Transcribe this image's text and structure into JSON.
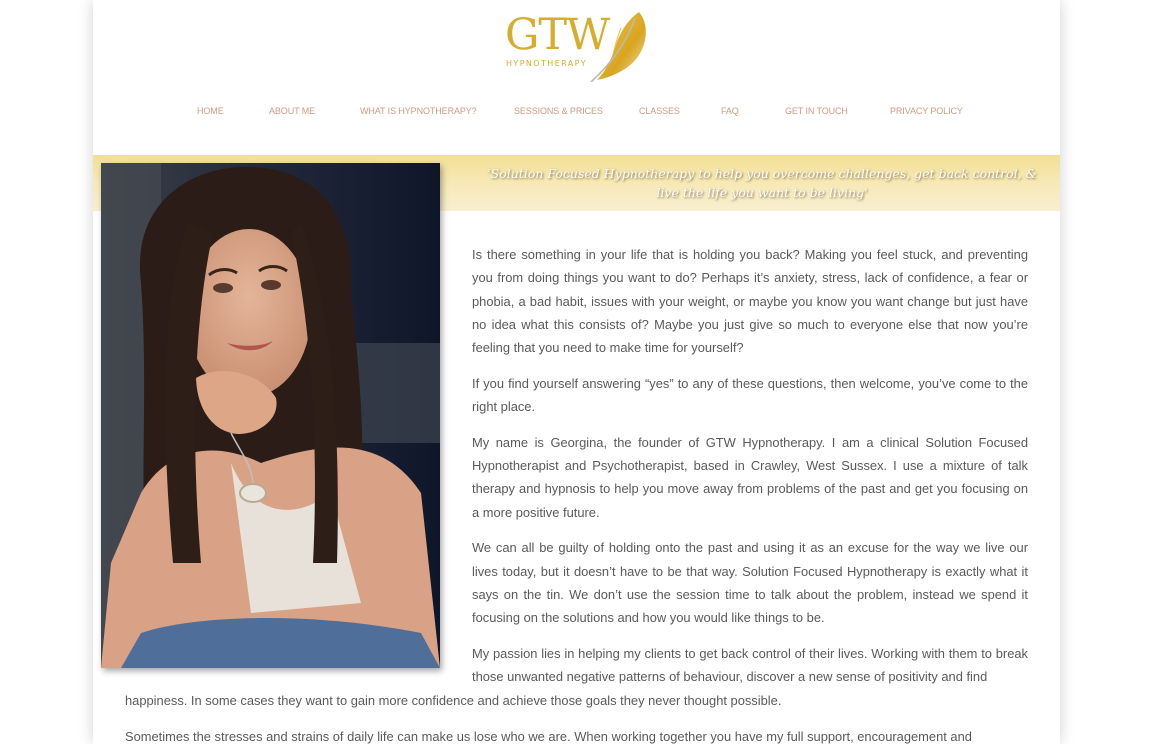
{
  "header": {
    "logo_text": "GTW",
    "logo_sub": "HYPNOTHERAPY"
  },
  "nav": {
    "items": [
      {
        "label": "HOME"
      },
      {
        "label": "ABOUT ME"
      },
      {
        "label": "WHAT IS HYPNOTHERAPY?"
      },
      {
        "label": "SESSIONS & PRICES"
      },
      {
        "label": "CLASSES"
      },
      {
        "label": "FAQ"
      },
      {
        "label": "GET IN TOUCH"
      },
      {
        "label": "PRIVACY POLICY"
      }
    ]
  },
  "banner": {
    "tagline": "'Solution Focused Hypnotherapy to help you overcome challenges, get back control, & live the life you want to be living'"
  },
  "content": {
    "paragraphs": [
      "Is there something in your life that is holding you back? Making you feel stuck, and preventing you from doing things you want to do? Perhaps it’s anxiety, stress, lack of confidence, a fear or phobia, a bad habit, issues with your weight, or maybe you know you want change but just have no idea what this consists of? Maybe you just give so much to everyone else that now you’re feeling that you need to make time for yourself?",
      "If you find yourself answering “yes” to any of these questions, then welcome, you’ve come to the right place.",
      "My name is Georgina, the founder of GTW Hypnotherapy. I am a clinical Solution Focused Hypnotherapist and Psychotherapist, based in Crawley, West Sussex. I use a mixture of talk therapy and hypnosis to help you move away from problems of the past and get you focusing on a more positive future.",
      "We can all be guilty of holding onto the past and using it as an excuse for the way we live our lives today, but it doesn’t have to be that way. Solution Focused Hypnotherapy is exactly what it says on the tin. We don’t use the session time to talk about the problem, instead we spend it focusing on the solutions and how you would like things to be.",
      "My passion lies in helping my clients to get back control of their lives. Working with them to break those unwanted negative patterns of behaviour, discover a new sense of positivity and find",
      "happiness. In some cases they want to gain more confidence and achieve those goals they never thought possible.",
      "Sometimes the stresses and strains of daily life can make us lose who we are. When working together you have my full support, encouragement and"
    ]
  },
  "colors": {
    "brand_gold": "#d8ad2e",
    "nav_text": "#d39a84",
    "body_text": "#5a5a5a",
    "banner": "#f4e3a6"
  }
}
